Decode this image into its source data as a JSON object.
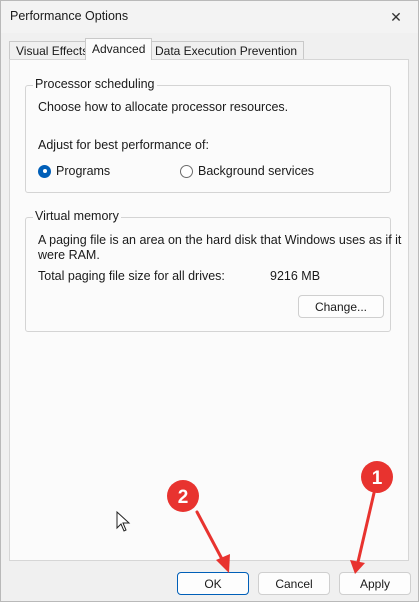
{
  "window": {
    "title": "Performance Options",
    "close_glyph": "✕"
  },
  "tabs": [
    {
      "label": "Visual Effects"
    },
    {
      "label": "Advanced"
    },
    {
      "label": "Data Execution Prevention"
    }
  ],
  "processor": {
    "title": "Processor scheduling",
    "description": "Choose how to allocate processor resources.",
    "adjust_label": "Adjust for best performance of:",
    "options": [
      {
        "label": "Programs",
        "selected": true
      },
      {
        "label": "Background services",
        "selected": false
      }
    ]
  },
  "virtual_memory": {
    "title": "Virtual memory",
    "description_line1": "A paging file is an area on the hard disk that Windows uses as if it",
    "description_line2": "were RAM.",
    "total_label": "Total paging file size for all drives:",
    "total_value": "9216 MB",
    "change_button": "Change..."
  },
  "footer": {
    "ok": "OK",
    "cancel": "Cancel",
    "apply": "Apply"
  },
  "annotations": [
    {
      "label": "1",
      "color": "#e8332f"
    },
    {
      "label": "2",
      "color": "#e8332f"
    }
  ]
}
